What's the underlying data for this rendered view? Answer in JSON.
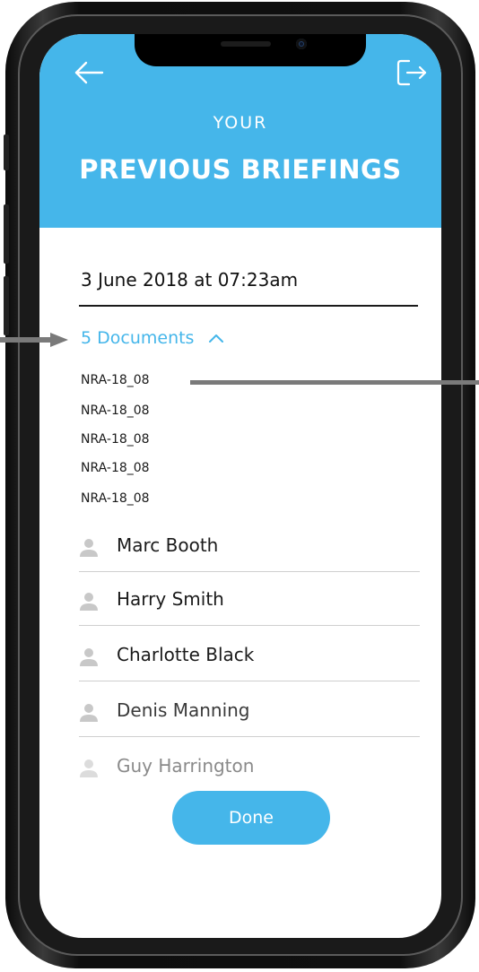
{
  "header": {
    "subtitle": "YOUR",
    "title": "PREVIOUS BRIEFINGS"
  },
  "briefing": {
    "date": "3 June 2018 at 07:23am",
    "documents_toggle": "5 Documents",
    "documents": [
      "NRA-18_08",
      "NRA-18_08",
      "NRA-18_08",
      "NRA-18_08",
      "NRA-18_08"
    ]
  },
  "people": [
    {
      "name": "Marc Booth"
    },
    {
      "name": "Harry Smith"
    },
    {
      "name": "Charlotte Black"
    },
    {
      "name": "Denis Manning"
    },
    {
      "name": "Guy Harrington"
    }
  ],
  "actions": {
    "done_label": "Done"
  },
  "colors": {
    "accent": "#45b6ea",
    "text": "#1a1a1a",
    "avatar": "#c8c8c8"
  },
  "icons": {
    "back": "arrow-left-icon",
    "logout": "logout-icon",
    "toggle": "chevron-up-icon",
    "person": "person-icon"
  }
}
